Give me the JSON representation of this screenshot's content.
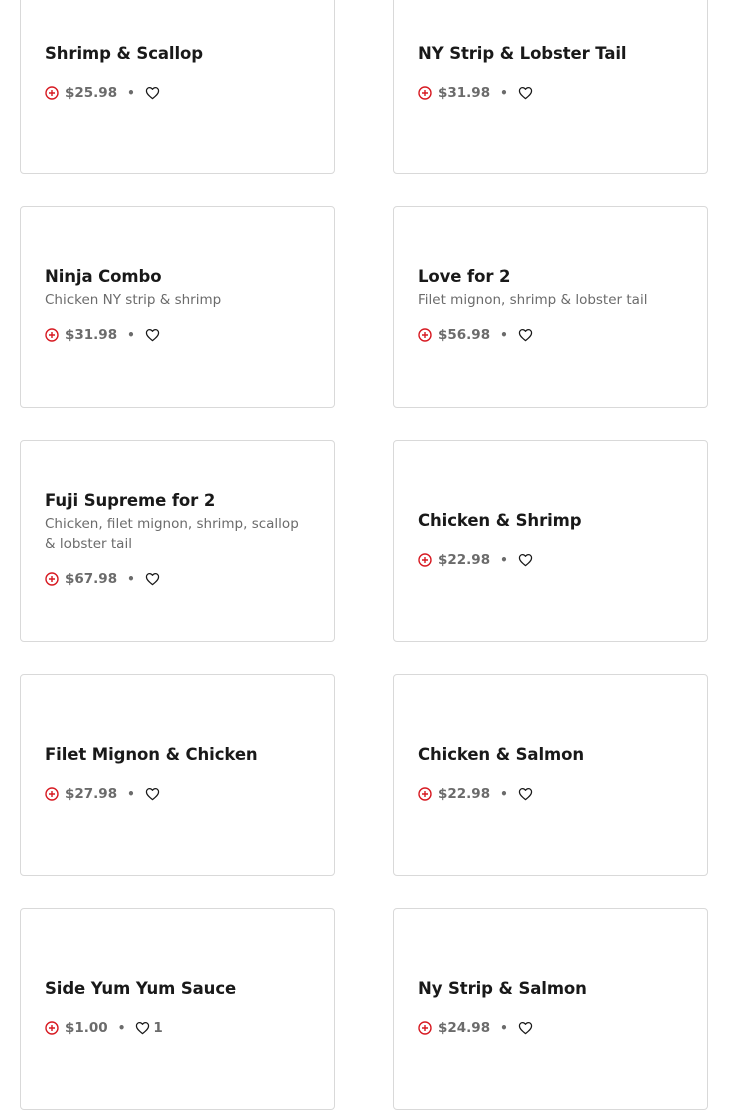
{
  "accent_color": "#d71921",
  "items": [
    {
      "name": "Shrimp & Scallop",
      "description": "",
      "price": "$25.98",
      "likes": ""
    },
    {
      "name": "NY Strip & Lobster Tail",
      "description": "",
      "price": "$31.98",
      "likes": ""
    },
    {
      "name": "Ninja Combo",
      "description": "Chicken NY strip & shrimp",
      "price": "$31.98",
      "likes": ""
    },
    {
      "name": "Love for 2",
      "description": "Filet mignon, shrimp & lobster tail",
      "price": "$56.98",
      "likes": ""
    },
    {
      "name": "Fuji Supreme for 2",
      "description": "Chicken, filet mignon, shrimp, scallop & lobster tail",
      "price": "$67.98",
      "likes": ""
    },
    {
      "name": "Chicken & Shrimp",
      "description": "",
      "price": "$22.98",
      "likes": ""
    },
    {
      "name": "Filet Mignon & Chicken",
      "description": "",
      "price": "$27.98",
      "likes": ""
    },
    {
      "name": "Chicken & Salmon",
      "description": "",
      "price": "$22.98",
      "likes": ""
    },
    {
      "name": "Side Yum Yum Sauce",
      "description": "",
      "price": "$1.00",
      "likes": "1"
    },
    {
      "name": "Ny Strip & Salmon",
      "description": "",
      "price": "$24.98",
      "likes": ""
    }
  ],
  "separator": "•",
  "icons": {
    "add": "add-circle-icon",
    "favorite": "heart-outline-icon"
  }
}
